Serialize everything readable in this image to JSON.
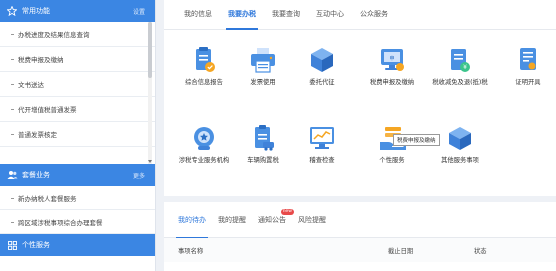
{
  "sidebar": {
    "common": {
      "icon": "star-icon",
      "title": "常用功能",
      "more": "设置",
      "items": [
        "办税进度及结果信息查询",
        "税费申报及缴纳",
        "文书送达",
        "代开增值税普通发票",
        "普通发票核定"
      ]
    },
    "agent": {
      "icon": "user-group-icon",
      "title": "套餐业务",
      "more": "更多",
      "items": [
        "新办纳税人套餐服务",
        "跨区域涉税事项综合办理套餐"
      ]
    },
    "personal": {
      "icon": "grid-icon",
      "title": "个性服务"
    }
  },
  "top_tabs": [
    "我的信息",
    "我要办税",
    "我要查询",
    "互动中心",
    "公众服务"
  ],
  "top_tab_active": 1,
  "functions": [
    {
      "label": "综合信息报告",
      "icon": "report-icon"
    },
    {
      "label": "发票使用",
      "icon": "printer-icon"
    },
    {
      "label": "委托代征",
      "icon": "box-icon"
    },
    {
      "label": "税费申报及缴纳",
      "icon": "tax-declare-icon"
    },
    {
      "label": "税收减免及退(抵)税",
      "icon": "tax-refund-icon"
    },
    {
      "label": "证明开具",
      "icon": "certificate-icon"
    },
    {
      "label": "涉税专业服务机构",
      "icon": "agency-icon"
    },
    {
      "label": "车辆购置税",
      "icon": "vehicle-tax-icon"
    },
    {
      "label": "稽查检查",
      "icon": "monitor-chart-icon"
    },
    {
      "label": "个性服务",
      "icon": "hand-service-icon"
    },
    {
      "label": "其他服务事项",
      "icon": "layers-icon"
    }
  ],
  "tooltip": "税费申报及缴纳",
  "bottom_tabs": [
    "我的待办",
    "我的提醒",
    "通知公告",
    "风险提醒"
  ],
  "bottom_tab_active": 0,
  "new_badge": "new",
  "table_headers": [
    "事项名称",
    "截止日期",
    "状态"
  ],
  "colors": {
    "accent": "#2f78db",
    "sidebar_header": "#3b86e3",
    "badge": "#e84a4a"
  }
}
